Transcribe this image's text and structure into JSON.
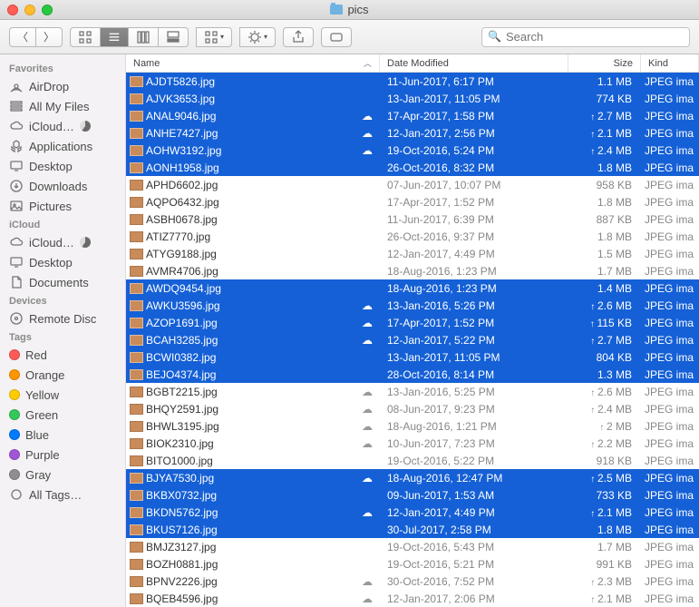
{
  "window": {
    "title": "pics"
  },
  "search": {
    "placeholder": "Search"
  },
  "columns": {
    "name": "Name",
    "date": "Date Modified",
    "size": "Size",
    "kind": "Kind"
  },
  "sidebar": {
    "groups": [
      {
        "label": "Favorites",
        "items": [
          {
            "label": "AirDrop",
            "icon": "airdrop"
          },
          {
            "label": "All My Files",
            "icon": "all"
          },
          {
            "label": "iCloud…",
            "icon": "cloud",
            "progress": true
          },
          {
            "label": "Applications",
            "icon": "apps"
          },
          {
            "label": "Desktop",
            "icon": "desktop"
          },
          {
            "label": "Downloads",
            "icon": "downloads"
          },
          {
            "label": "Pictures",
            "icon": "pictures"
          }
        ]
      },
      {
        "label": "iCloud",
        "items": [
          {
            "label": "iCloud…",
            "icon": "cloud",
            "progress": true
          },
          {
            "label": "Desktop",
            "icon": "desktop"
          },
          {
            "label": "Documents",
            "icon": "documents"
          }
        ]
      },
      {
        "label": "Devices",
        "items": [
          {
            "label": "Remote Disc",
            "icon": "disc"
          }
        ]
      },
      {
        "label": "Tags",
        "items": [
          {
            "label": "Red",
            "color": "#ff5b56"
          },
          {
            "label": "Orange",
            "color": "#ff9500"
          },
          {
            "label": "Yellow",
            "color": "#ffcc00"
          },
          {
            "label": "Green",
            "color": "#34c759"
          },
          {
            "label": "Blue",
            "color": "#007aff"
          },
          {
            "label": "Purple",
            "color": "#a156d6"
          },
          {
            "label": "Gray",
            "color": "#8e8e93"
          },
          {
            "label": "All Tags…",
            "icon": "alltags"
          }
        ]
      }
    ]
  },
  "files": [
    {
      "name": "AJDT5826.jpg",
      "date": "11-Jun-2017, 6:17 PM",
      "size": "1.1 MB",
      "kind": "JPEG ima",
      "sel": true
    },
    {
      "name": "AJVK3653.jpg",
      "date": "13-Jan-2017, 11:05 PM",
      "size": "774 KB",
      "kind": "JPEG ima",
      "sel": true
    },
    {
      "name": "ANAL9046.jpg",
      "date": "17-Apr-2017, 1:58 PM",
      "size": "2.7 MB",
      "kind": "JPEG ima",
      "sel": true,
      "cloud": true,
      "up": true
    },
    {
      "name": "ANHE7427.jpg",
      "date": "12-Jan-2017, 2:56 PM",
      "size": "2.1 MB",
      "kind": "JPEG ima",
      "sel": true,
      "cloud": true,
      "up": true
    },
    {
      "name": "AOHW3192.jpg",
      "date": "19-Oct-2016, 5:24 PM",
      "size": "2.4 MB",
      "kind": "JPEG ima",
      "sel": true,
      "cloud": true,
      "up": true
    },
    {
      "name": "AONH1958.jpg",
      "date": "26-Oct-2016, 8:32 PM",
      "size": "1.8 MB",
      "kind": "JPEG ima",
      "sel": true
    },
    {
      "name": "APHD6602.jpg",
      "date": "07-Jun-2017, 10:07 PM",
      "size": "958 KB",
      "kind": "JPEG ima"
    },
    {
      "name": "AQPO6432.jpg",
      "date": "17-Apr-2017, 1:52 PM",
      "size": "1.8 MB",
      "kind": "JPEG ima"
    },
    {
      "name": "ASBH0678.jpg",
      "date": "11-Jun-2017, 6:39 PM",
      "size": "887 KB",
      "kind": "JPEG ima"
    },
    {
      "name": "ATIZ7770.jpg",
      "date": "26-Oct-2016, 9:37 PM",
      "size": "1.8 MB",
      "kind": "JPEG ima"
    },
    {
      "name": "ATYG9188.jpg",
      "date": "12-Jan-2017, 4:49 PM",
      "size": "1.5 MB",
      "kind": "JPEG ima"
    },
    {
      "name": "AVMR4706.jpg",
      "date": "18-Aug-2016, 1:23 PM",
      "size": "1.7 MB",
      "kind": "JPEG ima"
    },
    {
      "name": "AWDQ9454.jpg",
      "date": "18-Aug-2016, 1:23 PM",
      "size": "1.4 MB",
      "kind": "JPEG ima",
      "sel": true
    },
    {
      "name": "AWKU3596.jpg",
      "date": "13-Jan-2016, 5:26 PM",
      "size": "2.6 MB",
      "kind": "JPEG ima",
      "sel": true,
      "cloud": true,
      "up": true
    },
    {
      "name": "AZOP1691.jpg",
      "date": "17-Apr-2017, 1:52 PM",
      "size": "115 KB",
      "kind": "JPEG ima",
      "sel": true,
      "cloud": true,
      "up": true
    },
    {
      "name": "BCAH3285.jpg",
      "date": "12-Jan-2017, 5:22 PM",
      "size": "2.7 MB",
      "kind": "JPEG ima",
      "sel": true,
      "cloud": true,
      "up": true
    },
    {
      "name": "BCWI0382.jpg",
      "date": "13-Jan-2017, 11:05 PM",
      "size": "804 KB",
      "kind": "JPEG ima",
      "sel": true
    },
    {
      "name": "BEJO4374.jpg",
      "date": "28-Oct-2016, 8:14 PM",
      "size": "1.3 MB",
      "kind": "JPEG ima",
      "sel": true
    },
    {
      "name": "BGBT2215.jpg",
      "date": "13-Jan-2016, 5:25 PM",
      "size": "2.6 MB",
      "kind": "JPEG ima",
      "cloud": true,
      "up": true
    },
    {
      "name": "BHQY2591.jpg",
      "date": "08-Jun-2017, 9:23 PM",
      "size": "2.4 MB",
      "kind": "JPEG ima",
      "cloud": true,
      "up": true
    },
    {
      "name": "BHWL3195.jpg",
      "date": "18-Aug-2016, 1:21 PM",
      "size": "2 MB",
      "kind": "JPEG ima",
      "cloud": true,
      "up": true
    },
    {
      "name": "BIOK2310.jpg",
      "date": "10-Jun-2017, 7:23 PM",
      "size": "2.2 MB",
      "kind": "JPEG ima",
      "cloud": true,
      "up": true
    },
    {
      "name": "BITO1000.jpg",
      "date": "19-Oct-2016, 5:22 PM",
      "size": "918 KB",
      "kind": "JPEG ima"
    },
    {
      "name": "BJYA7530.jpg",
      "date": "18-Aug-2016, 12:47 PM",
      "size": "2.5 MB",
      "kind": "JPEG ima",
      "sel": true,
      "cloud": true,
      "up": true
    },
    {
      "name": "BKBX0732.jpg",
      "date": "09-Jun-2017, 1:53 AM",
      "size": "733 KB",
      "kind": "JPEG ima",
      "sel": true
    },
    {
      "name": "BKDN5762.jpg",
      "date": "12-Jan-2017, 4:49 PM",
      "size": "2.1 MB",
      "kind": "JPEG ima",
      "sel": true,
      "cloud": true,
      "up": true
    },
    {
      "name": "BKUS7126.jpg",
      "date": "30-Jul-2017, 2:58 PM",
      "size": "1.8 MB",
      "kind": "JPEG ima",
      "sel": true
    },
    {
      "name": "BMJZ3127.jpg",
      "date": "19-Oct-2016, 5:43 PM",
      "size": "1.7 MB",
      "kind": "JPEG ima"
    },
    {
      "name": "BOZH0881.jpg",
      "date": "19-Oct-2016, 5:21 PM",
      "size": "991 KB",
      "kind": "JPEG ima"
    },
    {
      "name": "BPNV2226.jpg",
      "date": "30-Oct-2016, 7:52 PM",
      "size": "2.3 MB",
      "kind": "JPEG ima",
      "cloud": true,
      "up": true
    },
    {
      "name": "BQEB4596.jpg",
      "date": "12-Jan-2017, 2:06 PM",
      "size": "2.1 MB",
      "kind": "JPEG ima",
      "cloud": true,
      "up": true
    }
  ]
}
